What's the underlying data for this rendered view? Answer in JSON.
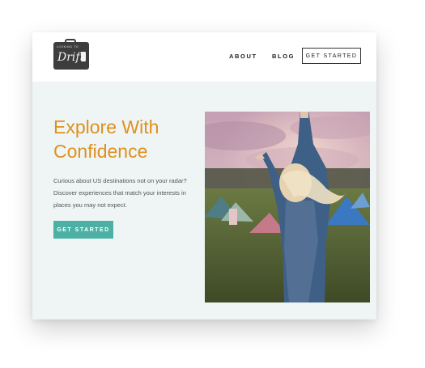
{
  "logo": {
    "top_text": "LOOKING TO",
    "script_text": "Drift"
  },
  "nav": {
    "about": "ABOUT",
    "blog": "BLOG",
    "cta": "GET STARTED"
  },
  "hero": {
    "title": "Explore With Confidence",
    "description": "Curious about US destinations not on your radar? Discover experiences that match your interests in places you may not expect.",
    "button": "GET STARTED"
  },
  "colors": {
    "accent": "#e0901d",
    "button": "#4cb1a4",
    "hero_bg": "#eef5f4"
  }
}
